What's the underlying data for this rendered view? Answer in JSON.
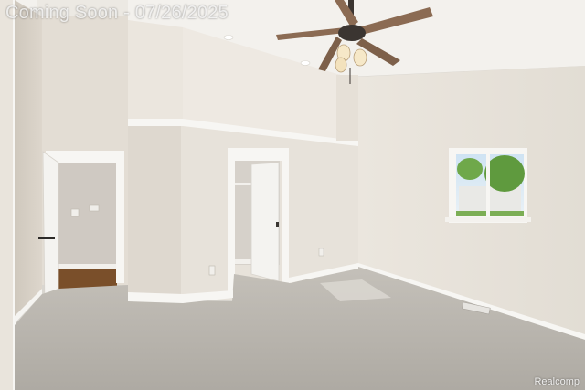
{
  "listing_photo": {
    "status_watermark": "Coming Soon - 07/26/2025",
    "credit_watermark": "Realcomp",
    "colors": {
      "wall": "#e7e2da",
      "ceiling": "#f3f1ed",
      "carpet": "#b9b5ae",
      "trim": "#f7f6f3",
      "door": "#f4f3f0",
      "wood_floor": "#7a4f2a",
      "fan_blade": "#8b6b53",
      "window_foliage": "#5f9a3e"
    }
  }
}
